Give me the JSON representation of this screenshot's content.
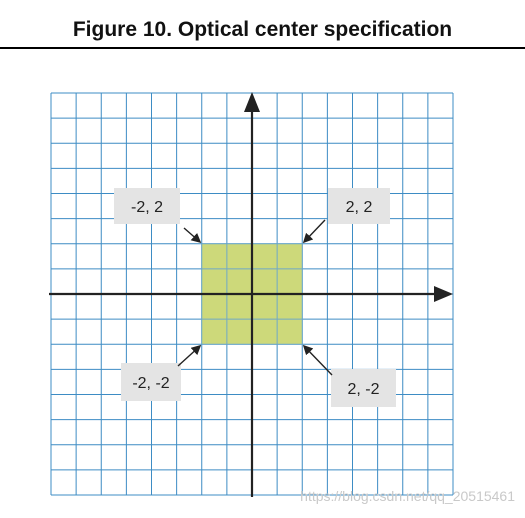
{
  "figure": {
    "title": "Figure 10. Optical center specification"
  },
  "diagram": {
    "grid_columns": 16,
    "grid_rows": 16,
    "center_square": {
      "x_min": -2,
      "x_max": 2,
      "y_min": -2,
      "y_max": 2
    },
    "corner_labels": [
      {
        "id": "top-left",
        "text": "-2, 2",
        "x": -2,
        "y": 2
      },
      {
        "id": "top-right",
        "text": "2, 2",
        "x": 2,
        "y": 2
      },
      {
        "id": "bottom-left",
        "text": "-2, -2",
        "x": -2,
        "y": -2
      },
      {
        "id": "bottom-right",
        "text": "2, -2",
        "x": 2,
        "y": -2
      }
    ],
    "colors": {
      "grid_line": "#3d8cc4",
      "axis": "#222222",
      "square_fill": "#cdd97a",
      "square_stroke": "#6fa9c8",
      "label_bg": "#e4e4e4",
      "arrow": "#222222"
    }
  },
  "watermark": "https://blog.csdn.net/qq_20515461"
}
